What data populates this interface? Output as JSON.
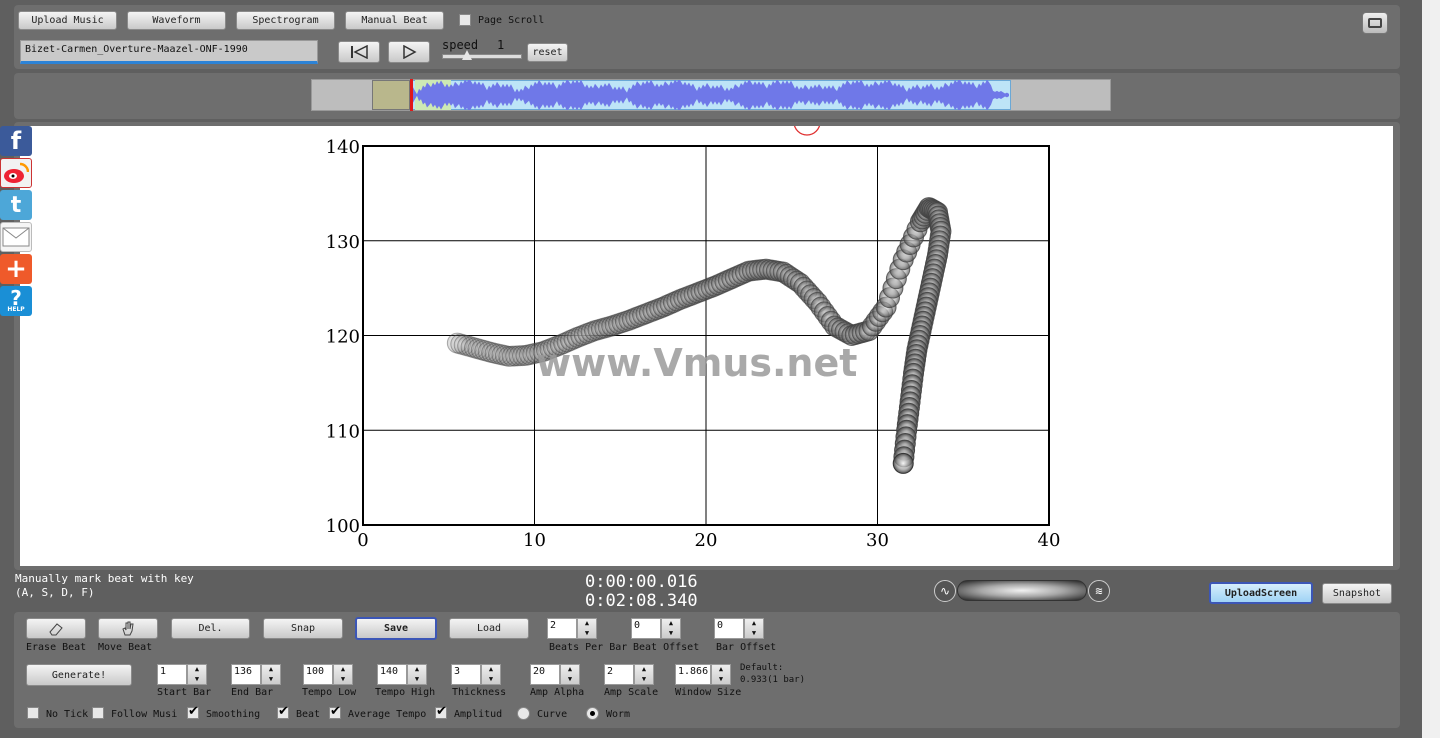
{
  "toolbar": {
    "upload_music": "Upload Music",
    "waveform": "Waveform",
    "spectrogram": "Spectrogram",
    "manual_beat": "Manual Beat",
    "page_scroll": "Page Scroll",
    "filename": "Bizet-Carmen_Overture-Maazel-ONF-1990",
    "speed_label": "speed",
    "speed_value": "1",
    "reset": "reset"
  },
  "chart": {
    "watermark": "www.Vmus.net"
  },
  "chart_data": {
    "type": "scatter",
    "title": "",
    "xlabel": "",
    "ylabel": "",
    "xlim": [
      0,
      40
    ],
    "ylim": [
      100,
      140
    ],
    "x_ticks": [
      "0",
      "10",
      "20",
      "30",
      "40"
    ],
    "y_ticks": [
      "100",
      "110",
      "120",
      "130",
      "140"
    ],
    "grid": true,
    "series": [
      {
        "x": [
          5.5,
          6.5,
          7.5,
          8.5,
          9.5,
          10.5,
          11.5,
          12.5,
          13.5,
          14.5,
          15.5,
          16.5,
          17.5,
          18.5,
          19.5,
          20.5,
          21.5,
          22.5,
          23.5,
          24.5,
          25.5,
          26.5,
          27.5,
          28.5,
          29.5,
          30.5,
          31.5,
          32.5,
          33,
          33.5,
          33.7,
          33.5,
          33.2,
          32.9,
          32.6,
          32.3,
          32.1,
          31.9,
          31.7,
          31.5
        ],
        "y": [
          119.2,
          118.7,
          118.2,
          117.8,
          117.9,
          118.3,
          119,
          119.8,
          120.5,
          121,
          121.6,
          122.3,
          123,
          123.8,
          124.5,
          125.2,
          126,
          126.8,
          127,
          126.7,
          125.5,
          123.5,
          121,
          120,
          120.5,
          123,
          128,
          132,
          133.5,
          133,
          131,
          128.5,
          126,
          123.5,
          121,
          118.5,
          116,
          113,
          110,
          106.5
        ]
      }
    ]
  },
  "bottom": {
    "hint_line1": "Manually mark beat with key",
    "hint_line2": "(A, S, D, F)",
    "time_current": "0:00:00.016",
    "time_total": "0:02:08.340",
    "upload_screen": "UploadScreen",
    "snapshot": "Snapshot"
  },
  "controls": {
    "erase_beat": "Erase Beat",
    "move_beat": "Move Beat",
    "del": "Del.",
    "snap": "Snap",
    "save": "Save",
    "load": "Load",
    "beats_per_bar_label": "Beats Per Bar",
    "beats_per_bar": "2",
    "beat_offset_label": "Beat Offset",
    "beat_offset": "0",
    "bar_offset_label": "Bar Offset",
    "bar_offset": "0",
    "generate": "Generate!",
    "start_bar_label": "Start Bar",
    "start_bar": "1",
    "end_bar_label": "End Bar",
    "end_bar": "136",
    "tempo_low_label": "Tempo Low",
    "tempo_low": "100",
    "tempo_high_label": "Tempo High",
    "tempo_high": "140",
    "thickness_label": "Thickness",
    "thickness": "3",
    "amp_alpha_label": "Amp Alpha",
    "amp_alpha": "20",
    "amp_scale_label": "Amp Scale",
    "amp_scale": "2",
    "window_size_label": "Window Size",
    "window_size": "1.866",
    "default_label": "Default:",
    "default_value": "0.933(1 bar)",
    "no_tick": "No Tick",
    "follow_music": "Follow Musi",
    "smoothing": "Smoothing",
    "beat": "Beat",
    "average_tempo": "Average Tempo",
    "amplitude": "Amplitud",
    "curve": "Curve",
    "worm": "Worm"
  }
}
